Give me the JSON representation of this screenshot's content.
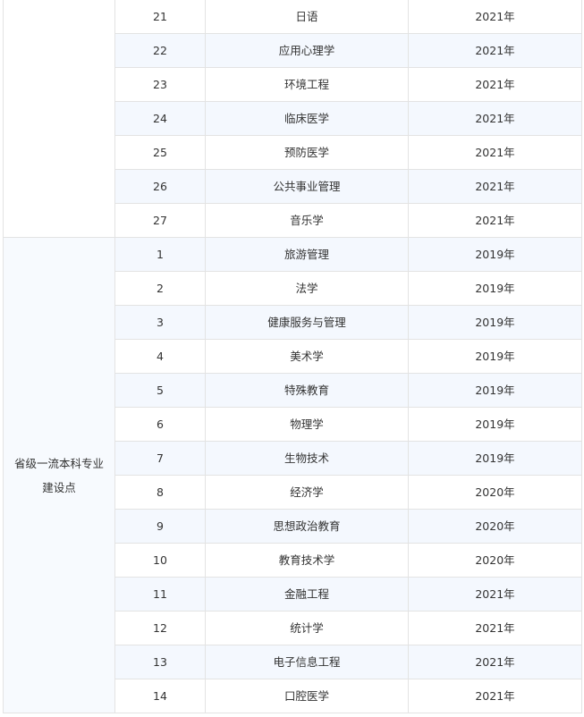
{
  "groups": [
    {
      "label": "",
      "rows": [
        {
          "no": "21",
          "major": "日语",
          "year": "2021年"
        },
        {
          "no": "22",
          "major": "应用心理学",
          "year": "2021年"
        },
        {
          "no": "23",
          "major": "环境工程",
          "year": "2021年"
        },
        {
          "no": "24",
          "major": "临床医学",
          "year": "2021年"
        },
        {
          "no": "25",
          "major": "预防医学",
          "year": "2021年"
        },
        {
          "no": "26",
          "major": "公共事业管理",
          "year": "2021年"
        },
        {
          "no": "27",
          "major": "音乐学",
          "year": "2021年"
        }
      ]
    },
    {
      "label": "省级一流本科专业建设点",
      "rows": [
        {
          "no": "1",
          "major": "旅游管理",
          "year": "2019年"
        },
        {
          "no": "2",
          "major": "法学",
          "year": "2019年"
        },
        {
          "no": "3",
          "major": "健康服务与管理",
          "year": "2019年"
        },
        {
          "no": "4",
          "major": "美术学",
          "year": "2019年"
        },
        {
          "no": "5",
          "major": "特殊教育",
          "year": "2019年"
        },
        {
          "no": "6",
          "major": "物理学",
          "year": "2019年"
        },
        {
          "no": "7",
          "major": "生物技术",
          "year": "2019年"
        },
        {
          "no": "8",
          "major": "经济学",
          "year": "2020年"
        },
        {
          "no": "9",
          "major": "思想政治教育",
          "year": "2020年"
        },
        {
          "no": "10",
          "major": "教育技术学",
          "year": "2020年"
        },
        {
          "no": "11",
          "major": "金融工程",
          "year": "2021年"
        },
        {
          "no": "12",
          "major": "统计学",
          "year": "2021年"
        },
        {
          "no": "13",
          "major": "电子信息工程",
          "year": "2021年"
        },
        {
          "no": "14",
          "major": "口腔医学",
          "year": "2021年"
        }
      ]
    }
  ]
}
